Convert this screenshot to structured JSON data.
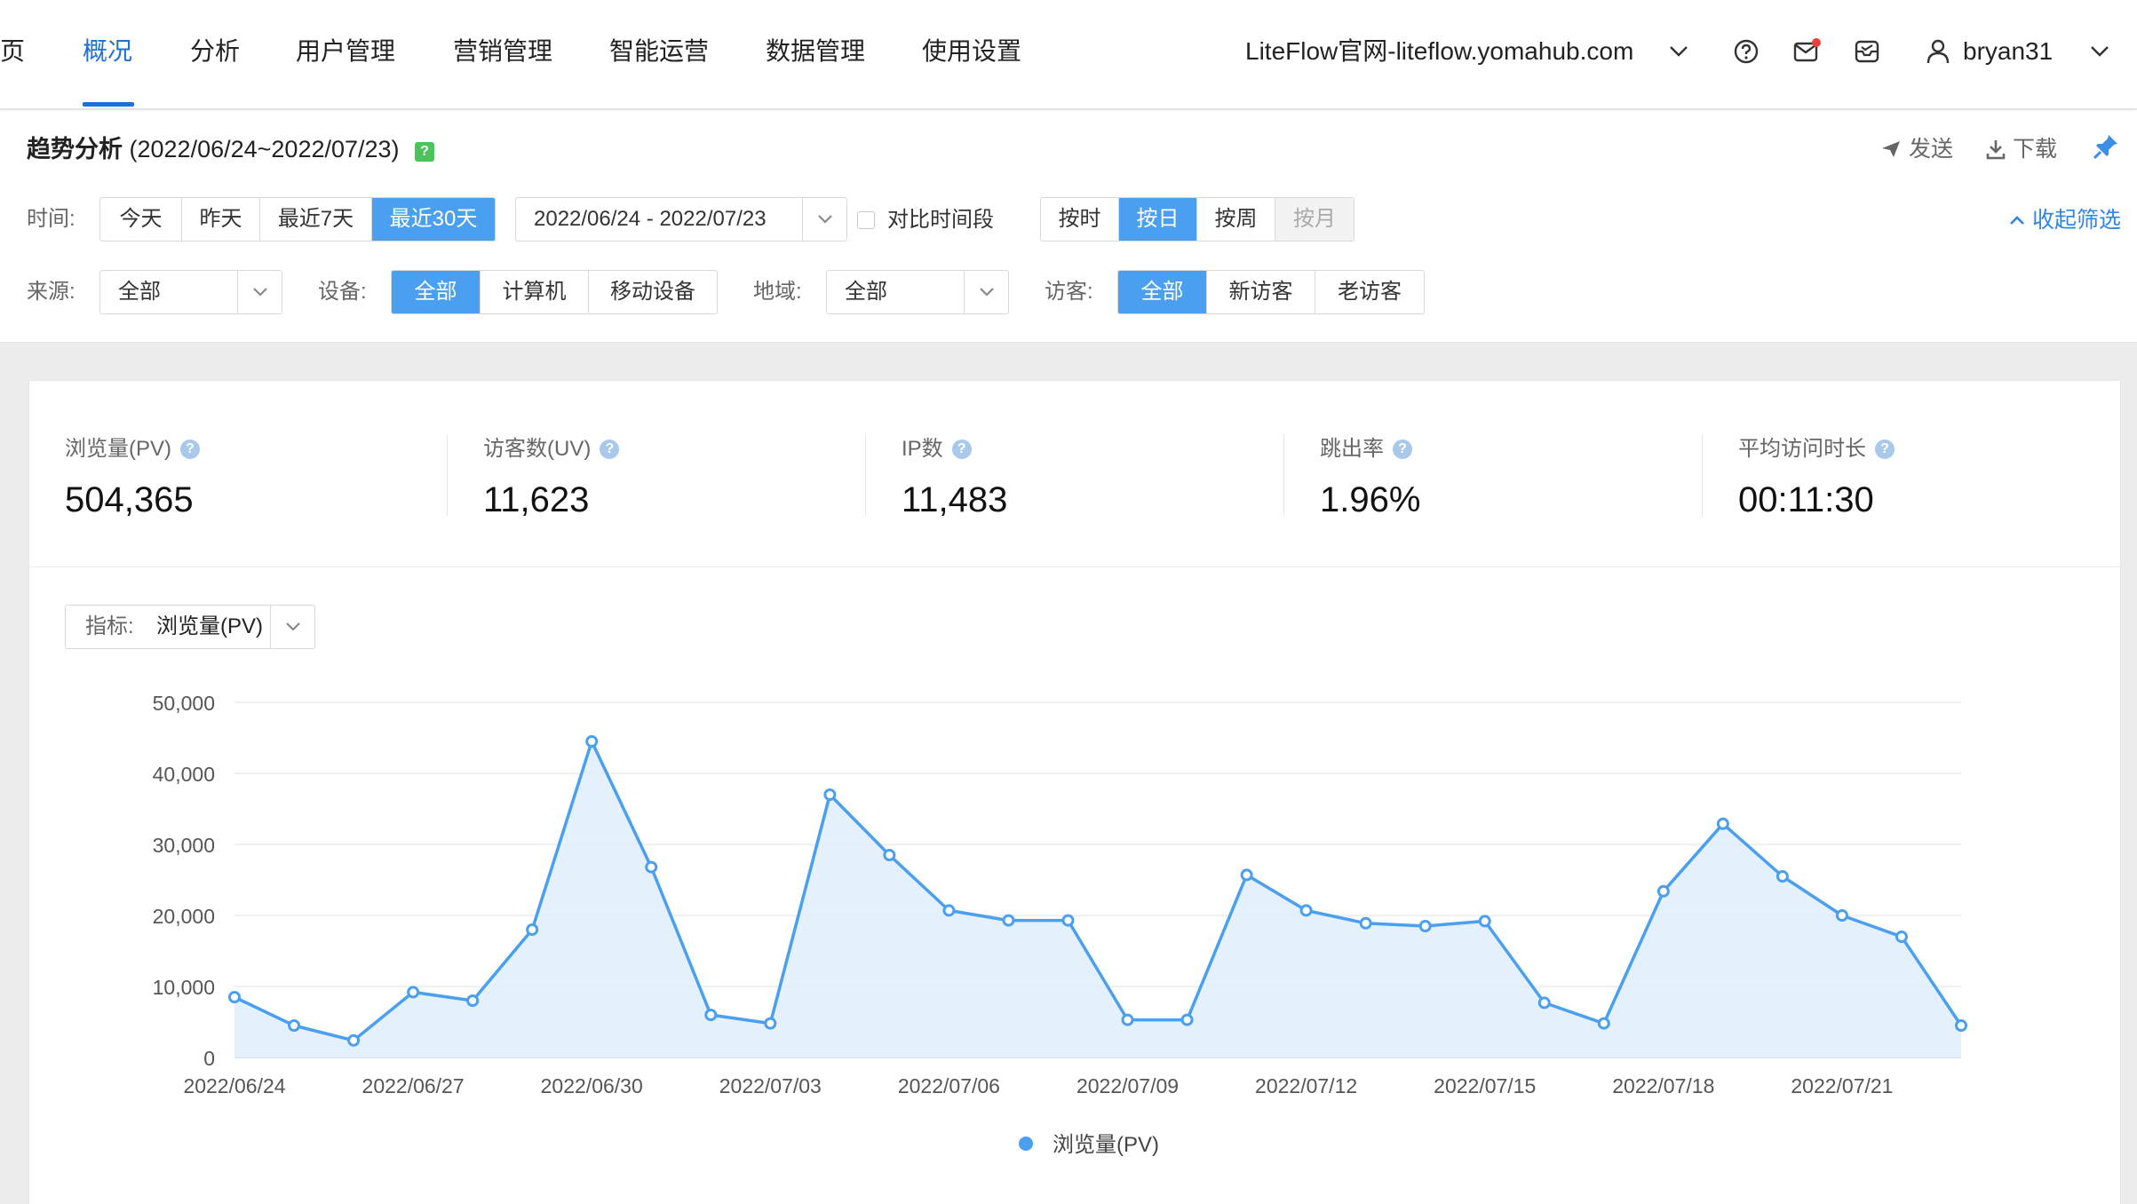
{
  "nav": {
    "tabs": [
      {
        "label": "页"
      },
      {
        "label": "概况",
        "active": true
      },
      {
        "label": "分析"
      },
      {
        "label": "用户管理"
      },
      {
        "label": "营销管理"
      },
      {
        "label": "智能运营"
      },
      {
        "label": "数据管理"
      },
      {
        "label": "使用设置"
      }
    ],
    "site": "LiteFlow官网-liteflow.yomahub.com",
    "user": "bryan31",
    "icons": [
      "help-icon",
      "mail-icon",
      "inbox-icon",
      "user-icon"
    ]
  },
  "header": {
    "title": "趋势分析",
    "range": "(2022/06/24~2022/07/23)",
    "help": "?",
    "send": "发送",
    "download": "下载"
  },
  "filters": {
    "time_label": "时间:",
    "time_opts": [
      "今天",
      "昨天",
      "最近7天",
      "最近30天"
    ],
    "date_range": "2022/06/24 - 2022/07/23",
    "compare": "对比时间段",
    "granularity": [
      "按时",
      "按日",
      "按周",
      "按月"
    ],
    "collapse": "收起筛选",
    "source_label": "来源:",
    "source_value": "全部",
    "device_label": "设备:",
    "device_opts": [
      "全部",
      "计算机",
      "移动设备"
    ],
    "region_label": "地域:",
    "region_value": "全部",
    "visitor_label": "访客:",
    "visitor_opts": [
      "全部",
      "新访客",
      "老访客"
    ]
  },
  "kpis": [
    {
      "label": "浏览量(PV)",
      "value": "504,365"
    },
    {
      "label": "访客数(UV)",
      "value": "11,623"
    },
    {
      "label": "IP数",
      "value": "11,483"
    },
    {
      "label": "跳出率",
      "value": "1.96%"
    },
    {
      "label": "平均访问时长",
      "value": "00:11:30"
    }
  ],
  "metric": {
    "label": "指标:",
    "value": "浏览量(PV)"
  },
  "colors": {
    "accent": "#1e6fd9",
    "active_btn": "#4a9ff0",
    "series": "#4a9ff0",
    "area": "#e1eefb",
    "badge_red": "#e8413b"
  },
  "chart_data": {
    "type": "area",
    "x": [
      "2022/06/24",
      "2022/06/25",
      "2022/06/26",
      "2022/06/27",
      "2022/06/28",
      "2022/06/29",
      "2022/06/30",
      "2022/07/01",
      "2022/07/02",
      "2022/07/03",
      "2022/07/04",
      "2022/07/05",
      "2022/07/06",
      "2022/07/07",
      "2022/07/08",
      "2022/07/09",
      "2022/07/10",
      "2022/07/11",
      "2022/07/12",
      "2022/07/13",
      "2022/07/14",
      "2022/07/15",
      "2022/07/16",
      "2022/07/17",
      "2022/07/18",
      "2022/07/19",
      "2022/07/20",
      "2022/07/21",
      "2022/07/22",
      "2022/07/23"
    ],
    "x_tick_labels": [
      "2022/06/24",
      "2022/06/27",
      "2022/06/30",
      "2022/07/03",
      "2022/07/06",
      "2022/07/09",
      "2022/07/12",
      "2022/07/15",
      "2022/07/18",
      "2022/07/21"
    ],
    "series": [
      {
        "name": "浏览量(PV)",
        "values": [
          8500,
          4500,
          2400,
          9200,
          8000,
          18000,
          44500,
          26800,
          6000,
          4800,
          37000,
          28500,
          20700,
          19300,
          19300,
          5300,
          5300,
          25700,
          20700,
          18900,
          18500,
          19200,
          7700,
          4800,
          23400,
          32900,
          25500,
          20000,
          17000,
          4500
        ]
      }
    ],
    "ylim": [
      0,
      50000
    ],
    "yticks": [
      "0",
      "10,000",
      "20,000",
      "30,000",
      "40,000",
      "50,000"
    ],
    "legend": "bottom-center",
    "grid": true
  }
}
